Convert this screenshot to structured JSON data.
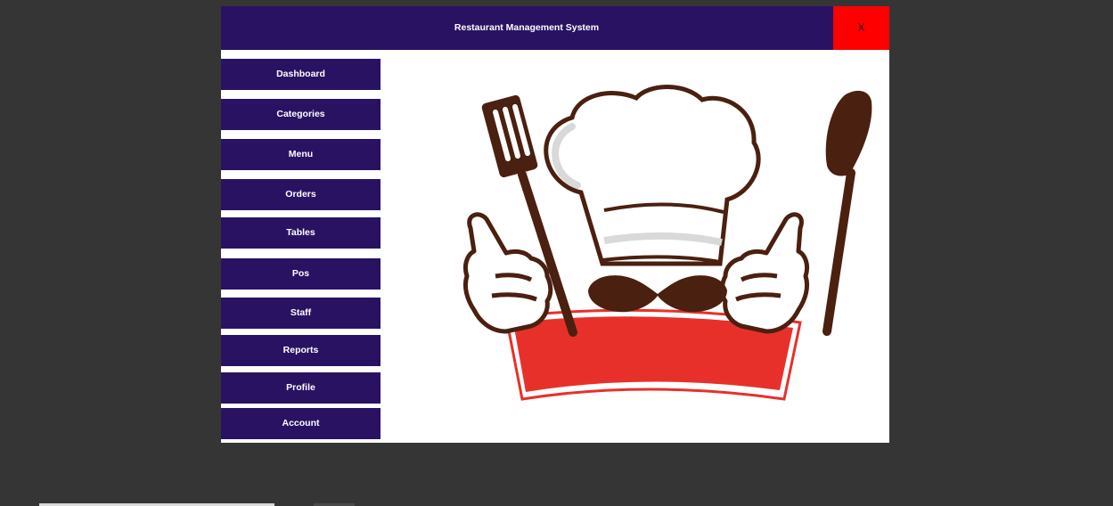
{
  "window": {
    "title": "Restaurant Management System",
    "close_label": "X",
    "brand_color": "#2a1263",
    "close_color": "#ff0000"
  },
  "sidebar": {
    "items": [
      {
        "label": "Dashboard"
      },
      {
        "label": "Categories"
      },
      {
        "label": "Menu"
      },
      {
        "label": "Orders"
      },
      {
        "label": "Tables"
      },
      {
        "label": "Pos"
      },
      {
        "label": "Staff"
      },
      {
        "label": "Reports"
      },
      {
        "label": "Profile"
      },
      {
        "label": "Account"
      }
    ]
  },
  "content": {
    "illustration": "chef-logo-illustration",
    "banner_color": "#e8302a",
    "outline_color": "#4a2010"
  }
}
